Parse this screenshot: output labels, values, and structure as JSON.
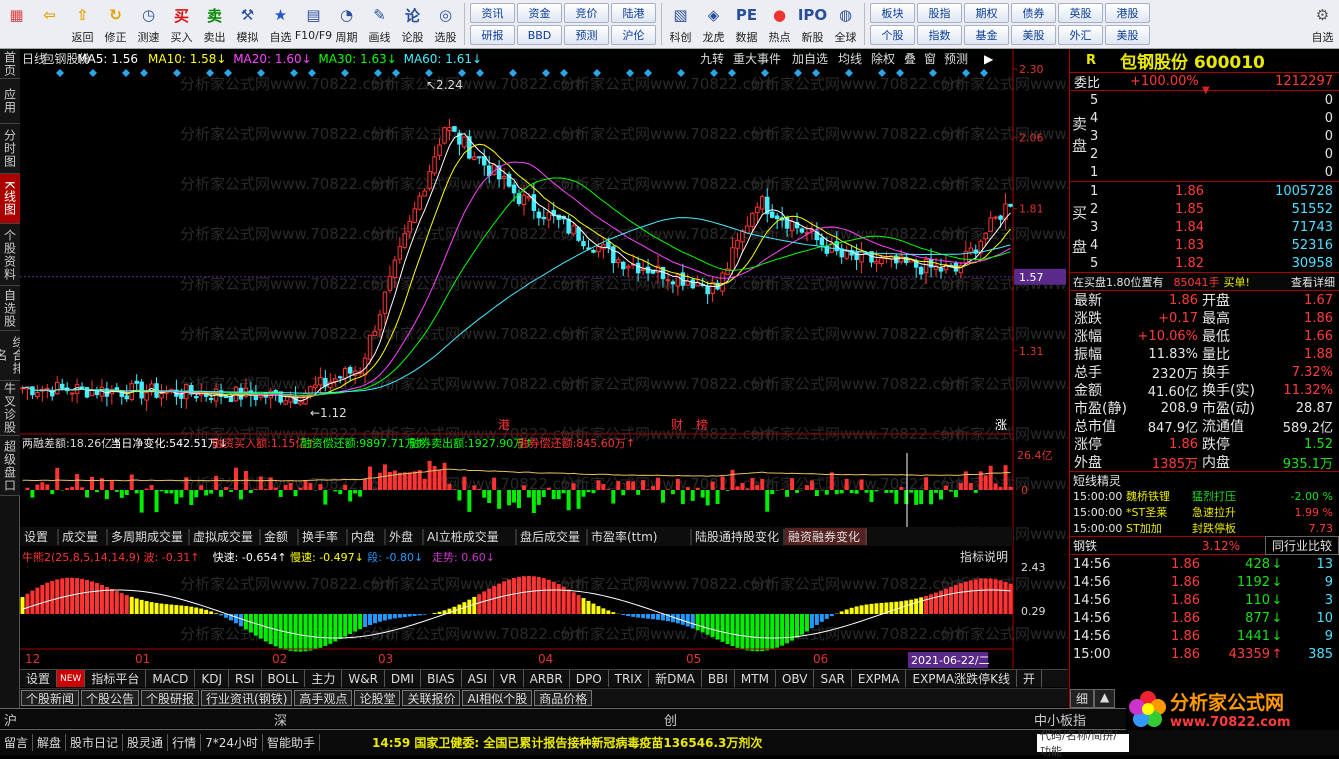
{
  "toolbar": {
    "buttons": [
      {
        "label": "",
        "icon": "windows-icon"
      },
      {
        "label": "",
        "icon": "back-arrow-icon"
      },
      {
        "label": "返回",
        "icon": "home-arrow-icon"
      },
      {
        "label": "修正",
        "icon": "refresh-icon"
      },
      {
        "label": "测速",
        "icon": "clock-icon"
      },
      {
        "label": "买入",
        "icon": "buy-icon"
      },
      {
        "label": "卖出",
        "icon": "sell-icon"
      },
      {
        "label": "模拟",
        "icon": "gavel-icon"
      },
      {
        "label": "自选",
        "icon": "star-icon"
      },
      {
        "label": "F10/F9",
        "icon": "f10-icon"
      },
      {
        "label": "周期",
        "icon": "cycle-icon"
      },
      {
        "label": "画线",
        "icon": "pen-icon"
      },
      {
        "label": "论股",
        "icon": "lun-icon"
      },
      {
        "label": "选股",
        "icon": "scan-icon"
      }
    ],
    "grid1": [
      "资讯",
      "资金",
      "竞价",
      "陆港",
      "研报",
      "BBD",
      "预测",
      "沪伦"
    ],
    "buttons2": [
      {
        "label": "科创",
        "icon": "kechuang-icon"
      },
      {
        "label": "龙虎",
        "icon": "dragon-icon"
      },
      {
        "label": "数据",
        "icon": "pe-icon"
      },
      {
        "label": "热点",
        "icon": "hot-icon"
      },
      {
        "label": "新股",
        "icon": "newstock-icon"
      },
      {
        "label": "全球",
        "icon": "globe-icon"
      }
    ],
    "grid2": [
      "板块",
      "股指",
      "期权",
      "债券",
      "英股",
      "港股",
      "个股",
      "指数",
      "基金",
      "美股",
      "外汇",
      "美股"
    ],
    "right_label": "自选"
  },
  "left_tabs": [
    "首页",
    "应用",
    "分时图",
    "K线图",
    "个股资料",
    "自选股",
    "综合排名",
    "牛叉诊股",
    "超级盘口"
  ],
  "chart": {
    "header": [
      "日线",
      "包钢股份",
      "MA5: 1.56",
      "MA10: 1.58↓",
      "MA20: 1.60↓",
      "MA30: 1.63↓",
      "MA60: 1.61↓"
    ],
    "header_right": [
      "九转",
      "重大事件",
      "加自选",
      "均线",
      "除权",
      "叠",
      "窗",
      "预测"
    ],
    "price_axis": [
      "2.30",
      "2.06",
      "1.81",
      "1.57",
      "1.31"
    ],
    "max_label": "2.24",
    "min_label": "1.12",
    "events": [
      "港",
      "财",
      "榜",
      "涨"
    ],
    "margin_header": [
      "两融差额:18.26亿↑",
      "当日净变化:542.51万↓",
      "融资买入额:1.15亿↑",
      "融资偿还额:9897.71万↑",
      "融券卖出额:1927.90万↑",
      "融券偿还额:845.60万↑"
    ],
    "margin_axis": [
      "26.4亿",
      "0"
    ],
    "sub_tabs": [
      "设置",
      "成交量",
      "多周期成交量",
      "虚拟成交量",
      "金额",
      "换手率",
      "内盘",
      "外盘",
      "AI立桩成交量",
      "盘后成交量",
      "市盈率(ttm)",
      "陆股通持股变化",
      "融资融券变化"
    ],
    "indicator_header": [
      "牛熊2(25,8,5,14,14,9) 波: -0.31↑",
      "快速: -0.654↑",
      "慢速: -0.497↓",
      "段: -0.80↓",
      "走势: 0.60↓"
    ],
    "indicator_btn": "指标说明",
    "indicator_axis": [
      "2.43",
      "0.29"
    ],
    "months": [
      "12",
      "01",
      "02",
      "03",
      "04",
      "05",
      "06"
    ],
    "date_label": "2021-06-22/二",
    "watermark": "分析家公式网www.70822.com"
  },
  "tabsbar": [
    "设置",
    "NEW",
    "指标平台",
    "MACD",
    "KDJ",
    "RSI",
    "BOLL",
    "主力",
    "W&R",
    "DMI",
    "BIAS",
    "ASI",
    "VR",
    "ARBR",
    "DPO",
    "TRIX",
    "新DMA",
    "BBI",
    "MTM",
    "OBV",
    "SAR",
    "EXPMA",
    "EXPMA涨跌停K线",
    "开"
  ],
  "newsbar": [
    "个股新闻",
    "个股公告",
    "个股研报",
    "行业资讯(钢铁)",
    "高手观点",
    "论股堂",
    "关联报价",
    "AI相似个股",
    "商品价格"
  ],
  "right": {
    "title": "包钢股份 600010",
    "r_label": "R",
    "weibi": {
      "label": "委比",
      "value": "+100.00%",
      "diff": "1212297"
    },
    "sell": [
      {
        "n": "5",
        "p": "",
        "v": "0"
      },
      {
        "n": "4",
        "p": "",
        "v": "0"
      },
      {
        "n": "3",
        "p": "",
        "v": "0"
      },
      {
        "n": "2",
        "p": "",
        "v": "0"
      },
      {
        "n": "1",
        "p": "",
        "v": "0"
      }
    ],
    "buy": [
      {
        "n": "1",
        "p": "1.86",
        "v": "1005728"
      },
      {
        "n": "2",
        "p": "1.85",
        "v": "51552"
      },
      {
        "n": "3",
        "p": "1.84",
        "v": "71743"
      },
      {
        "n": "4",
        "p": "1.83",
        "v": "52316"
      },
      {
        "n": "5",
        "p": "1.82",
        "v": "30958"
      }
    ],
    "sell_label": "卖盘",
    "buy_label": "买盘",
    "order_note": {
      "text": "在买盘1.80位置有",
      "qty": "85041手",
      "act": "买单!",
      "link": "查看详细"
    },
    "stats": [
      [
        "最新",
        "1.86",
        "开盘",
        "1.67"
      ],
      [
        "涨跌",
        "+0.17",
        "最高",
        "1.86"
      ],
      [
        "涨幅",
        "+10.06%",
        "最低",
        "1.66"
      ],
      [
        "振幅",
        "11.83%",
        "量比",
        "1.88"
      ],
      [
        "总手",
        "2320万",
        "换手",
        "7.32%"
      ],
      [
        "金额",
        "41.60亿",
        "换手(实)",
        "11.32%"
      ],
      [
        "市盈(静)",
        "208.9",
        "市盈(动)",
        "28.87"
      ],
      [
        "总市值",
        "847.9亿",
        "流通值",
        "589.2亿"
      ],
      [
        "涨停",
        "1.86",
        "跌停",
        "1.52"
      ],
      [
        "外盘",
        "1385万",
        "内盘",
        "935.1万"
      ]
    ],
    "short_title": "短线精灵",
    "short": [
      [
        "15:00:00",
        "魏桥铁锂",
        "猛烈打压",
        "-2.00 %"
      ],
      [
        "15:00:00",
        "*ST圣莱",
        "急速拉升",
        "1.99 %"
      ],
      [
        "15:00:00",
        "ST加加",
        "封跌停板",
        "7.73"
      ]
    ],
    "industry": {
      "name": "钢铁",
      "pct": "3.12%",
      "btn": "同行业比较"
    },
    "ticks": [
      [
        "14:56",
        "1.86",
        "428",
        "13"
      ],
      [
        "14:56",
        "1.86",
        "1192",
        "9"
      ],
      [
        "14:56",
        "1.86",
        "110",
        "3"
      ],
      [
        "14:56",
        "1.86",
        "877",
        "10"
      ],
      [
        "14:56",
        "1.86",
        "1441",
        "9"
      ],
      [
        "15:00",
        "1.86",
        "43359",
        "385"
      ]
    ],
    "bottom_tabs": [
      "细",
      "▲"
    ]
  },
  "market": [
    "沪",
    "深",
    "创",
    "中小板指"
  ],
  "status": [
    "留言",
    "解盘",
    "股市日记",
    "股灵通",
    "行情",
    "7*24小时",
    "智能助手"
  ],
  "news_ticker": "14:59 国家卫健委: 全国已累计报告接种新冠病毒疫苗136546.3万剂次",
  "search_placeholder": "代码/名称/简拼/功能",
  "logo": {
    "cn": "分析家公式网",
    "url": "www.70822.com"
  }
}
